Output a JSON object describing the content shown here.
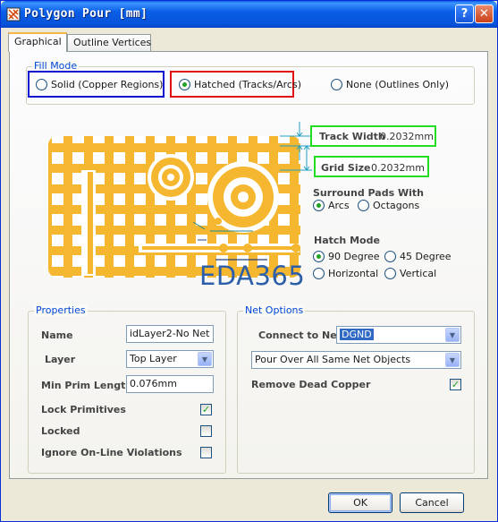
{
  "window": {
    "title": "Polygon Pour [mm]",
    "help_label": "?",
    "close_label": "✕"
  },
  "tabs": [
    {
      "label": "Graphical",
      "active": true
    },
    {
      "label": "Outline Vertices",
      "active": false
    }
  ],
  "fill_mode": {
    "label": "Fill Mode",
    "options": [
      {
        "label": "Solid (Copper Regions)",
        "selected": false
      },
      {
        "label": "Hatched (Tracks/Arcs)",
        "selected": true
      },
      {
        "label": "None (Outlines Only)",
        "selected": false
      }
    ]
  },
  "diagram": {
    "track_width_label": "Track Width",
    "track_width_value": "0.2032mm",
    "grid_size_label": "Grid Size",
    "grid_size_value": "0.2032mm",
    "surround_label": "Surround Pads With",
    "surround_options": [
      {
        "label": "Arcs",
        "selected": true
      },
      {
        "label": "Octagons",
        "selected": false
      }
    ],
    "hatch_label": "Hatch Mode",
    "hatch_options": [
      {
        "label": "90 Degree",
        "selected": true
      },
      {
        "label": "45 Degree",
        "selected": false
      },
      {
        "label": "Horizontal",
        "selected": false
      },
      {
        "label": "Vertical",
        "selected": false
      }
    ],
    "watermark": "EDA365",
    "copper_color": "#f5b730"
  },
  "properties": {
    "label": "Properties",
    "name_label": "Name",
    "name_value": "idLayer2-No Net",
    "layer_label": "Layer",
    "layer_value": "Top Layer",
    "min_prim_label": "Min Prim Length",
    "min_prim_value": "0.076mm",
    "lock_primitives_label": "Lock Primitives",
    "lock_primitives_checked": true,
    "locked_label": "Locked",
    "locked_checked": false,
    "ignore_label": "Ignore On-Line Violations",
    "ignore_checked": false
  },
  "net_options": {
    "label": "Net Options",
    "connect_label": "Connect to Net",
    "connect_value": "DGND",
    "pour_value": "Pour Over All Same Net Objects",
    "remove_dead_label": "Remove Dead Copper",
    "remove_dead_checked": true
  },
  "buttons": {
    "ok": "OK",
    "cancel": "Cancel"
  }
}
